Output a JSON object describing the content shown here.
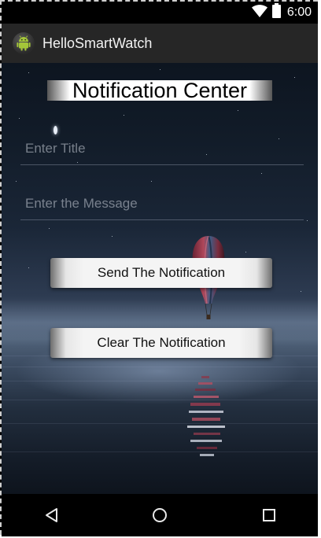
{
  "status_bar": {
    "time": "6:00",
    "icons": [
      "wifi-icon",
      "battery-icon"
    ]
  },
  "action_bar": {
    "app_icon": "android-icon",
    "title": "HelloSmartWatch"
  },
  "main": {
    "heading": "Notification Center",
    "title_input": {
      "value": "",
      "placeholder": "Enter Title"
    },
    "message_input": {
      "value": "",
      "placeholder": "Enter the Message"
    },
    "send_button_label": "Send The Notification",
    "clear_button_label": "Clear The Notification"
  },
  "nav_bar": {
    "icons": [
      "back-icon",
      "home-icon",
      "recents-icon"
    ]
  },
  "colors": {
    "status_bar": "#000000",
    "action_bar": "#262626",
    "nav_bar": "#000000",
    "button_face": "#f4f4f4"
  }
}
